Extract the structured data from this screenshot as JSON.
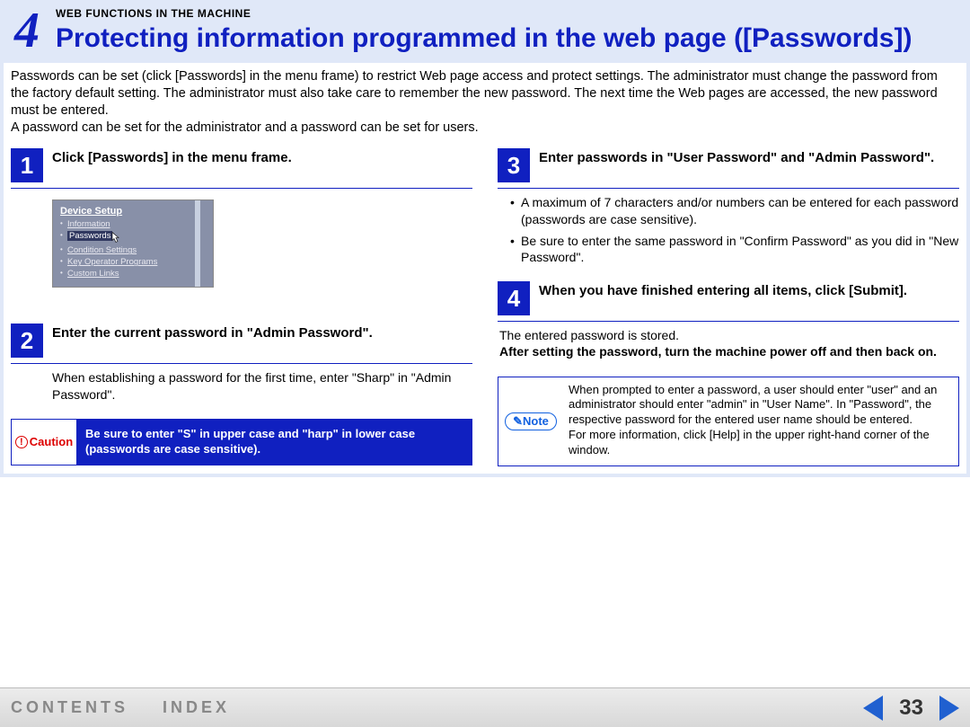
{
  "header": {
    "chapter_number": "4",
    "section_label": "WEB FUNCTIONS IN THE MACHINE",
    "title": "Protecting information programmed in the web page ([Passwords])"
  },
  "intro": {
    "p1": "Passwords can be set (click [Passwords] in the menu frame) to restrict Web page access and protect settings. The administrator must change the password from the factory default setting. The administrator must also take care to remember the new password. The next time the Web pages are accessed, the new password must be entered.",
    "p2": "A password can be set for the administrator and a password can be set for users."
  },
  "steps": {
    "s1": {
      "num": "1",
      "title": "Click [Passwords] in the menu frame."
    },
    "s2": {
      "num": "2",
      "title": "Enter the current password in \"Admin Password\".",
      "body": "When establishing a password for the first time, enter \"Sharp\" in \"Admin Password\"."
    },
    "s3": {
      "num": "3",
      "title": "Enter passwords in \"User Password\" and \"Admin Password\".",
      "b1": "A maximum of 7 characters and/or numbers can be entered for each password (passwords are case sensitive).",
      "b2": "Be sure to enter the same password in \"Confirm Password\" as you did in \"New Password\"."
    },
    "s4": {
      "num": "4",
      "title": "When you have finished entering all items, click [Submit].",
      "body1": "The entered password is stored.",
      "body2": "After setting the password, turn the machine power off and then back on."
    }
  },
  "caution": {
    "label": "Caution",
    "text": "Be sure to enter \"S\" in upper case and \"harp\" in lower case (passwords are case sensitive)."
  },
  "note": {
    "label": "Note",
    "p1": "When prompted to enter a password, a user should enter \"user\" and an administrator should enter \"admin\" in \"User Name\". In \"Password\", the respective password for the entered user name should be entered.",
    "p2": "For more information, click [Help] in the upper right-hand corner of the window."
  },
  "device_setup": {
    "heading": "Device Setup",
    "items": [
      "Information",
      "Passwords",
      "Condition Settings",
      "Key Operator Programs",
      "Custom Links"
    ],
    "highlighted_index": 1
  },
  "footer": {
    "contents": "CONTENTS",
    "index": "INDEX",
    "page": "33"
  }
}
